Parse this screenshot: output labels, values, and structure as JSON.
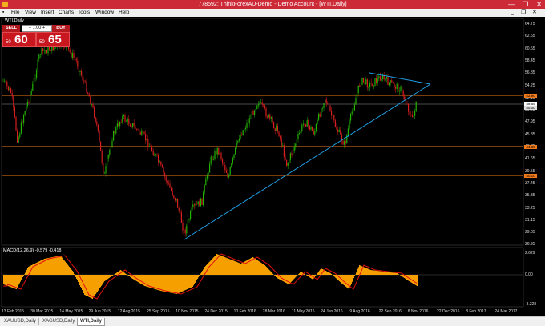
{
  "window": {
    "title": "778592: ThinkForexAU-Demo - Demo Account - [WTI,Daily]",
    "min_glyph": "—",
    "max_glyph": "❐",
    "close_glyph": "✕"
  },
  "menu": {
    "items": [
      "File",
      "View",
      "Insert",
      "Charts",
      "Tools",
      "Window",
      "Help"
    ],
    "mdi_min": "_",
    "mdi_max": "❐",
    "mdi_close": "✕"
  },
  "chart": {
    "symbol_label": "WTI,Daily",
    "indicator_label": "MACD(12,26,9) -0.579 -0.418",
    "price_axis": [
      "64.75",
      "62.65",
      "60.55",
      "58.45",
      "56.35",
      "54.25",
      "52.15",
      "50.05",
      "47.95",
      "45.85",
      "43.75",
      "41.65",
      "39.55",
      "37.45",
      "35.35",
      "33.25",
      "31.15",
      "29.05",
      "26.95"
    ],
    "indicator_axis": [
      "2.629",
      "0.00",
      "-3.228"
    ],
    "time_axis": [
      "13 Feb 2015",
      "30 Mar 2015",
      "14 May 2015",
      "29 Jun 2015",
      "12 Aug 2015",
      "25 Sep 2015",
      "10 Nov 2015",
      "24 Dec 2015",
      "10 Feb 2016",
      "28 Mar 2016",
      "11 May 2016",
      "24 Jun 2016",
      "9 Aug 2016",
      "22 Sep 2016",
      "8 Nov 2016",
      "22 Dec 2016",
      "8 Feb 2017",
      "24 Mar 2017"
    ],
    "hline_badges": [
      "52.90",
      "44.30",
      "40.10"
    ],
    "current_price_badge": "49.65",
    "bid_badge": "50.00"
  },
  "trade": {
    "sell_label": "SELL",
    "buy_label": "BUY",
    "lot_value": "1.00",
    "sell_small": "50",
    "sell_big": "60",
    "buy_small": "50",
    "buy_big": "65"
  },
  "tabs": [
    "XAUUSD,Daily",
    "XAGUSD,Daily",
    "WTI,Daily"
  ],
  "colors": {
    "bull_candle": "#22b400",
    "bear_candle": "#d81e1e",
    "hline": "#f07a1a",
    "trendline": "#1ea0e6",
    "macd_hist": "#f5a000",
    "macd_signal": "#e01010"
  }
}
